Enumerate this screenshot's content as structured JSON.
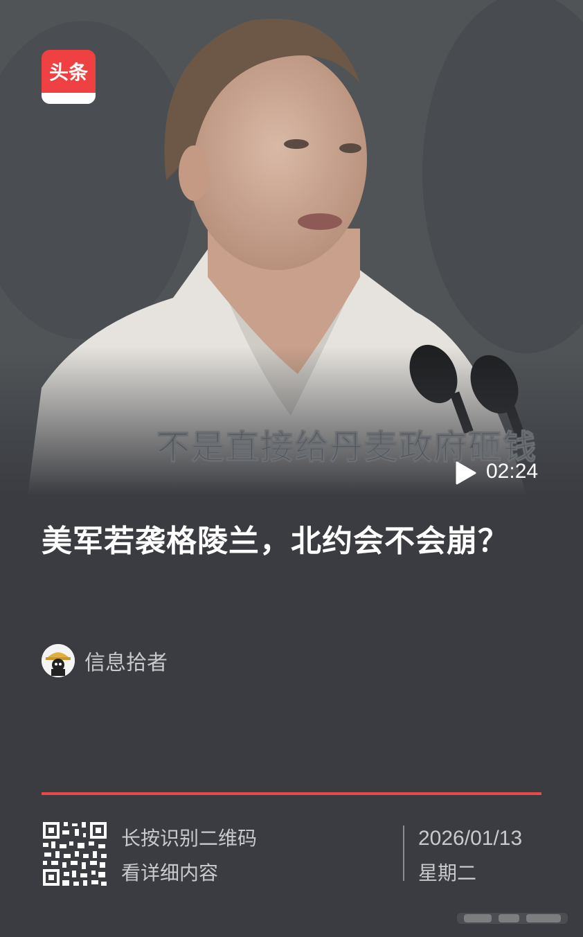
{
  "app": {
    "logo_text": "头条",
    "brand_color": "#f04142",
    "accent_line_color": "#e84a48",
    "background": "#3a3c41"
  },
  "video": {
    "caption": "不是直接给丹麦政府砸钱",
    "duration": "02:24",
    "play_icon": "play-icon"
  },
  "article": {
    "title": "美军若袭格陵兰，北约会不会崩？"
  },
  "author": {
    "name": "信息拾者",
    "avatar_icon": "avatar-icon"
  },
  "footer": {
    "qr_line1": "长按识别二维码",
    "qr_line2": "看详细内容",
    "date": "2026/01/13",
    "weekday": "星期二"
  }
}
